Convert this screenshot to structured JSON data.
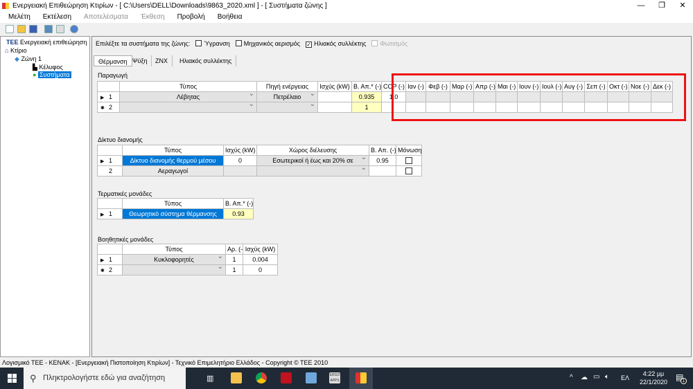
{
  "window": {
    "title": "Ενεργειακή Επιθεώρηση Κτιρίων - [ C:\\Users\\DELL\\Downloads\\9863_2020.xml ] - [ Συστήματα ζώνης ]"
  },
  "menu": [
    {
      "label": "Μελέτη",
      "enabled": true
    },
    {
      "label": "Εκτέλεση",
      "enabled": true
    },
    {
      "label": "Αποτελέσματα",
      "enabled": false
    },
    {
      "label": "Έκθεση",
      "enabled": false
    },
    {
      "label": "Προβολή",
      "enabled": true
    },
    {
      "label": "Βοήθεια",
      "enabled": true
    }
  ],
  "tree": {
    "root": "Ενεργειακή επιθεώρηση",
    "root_logo": "TEE",
    "building": "Κτίριο",
    "zone": "Ζώνη 1",
    "envelope": "Κέλυφος",
    "systems": "Συστήματα"
  },
  "systems_select": {
    "label": "Επιλέξτε τα συστήματα της ζώνης:",
    "options": [
      {
        "label": "Ύγρανση",
        "checked": false,
        "enabled": true
      },
      {
        "label": "Μηχανικός αερισμός",
        "checked": false,
        "enabled": true
      },
      {
        "label": "Ηλιακός συλλέκτης",
        "checked": true,
        "enabled": true
      },
      {
        "label": "Φωτισμός",
        "checked": false,
        "enabled": false
      }
    ]
  },
  "tabs": [
    {
      "label": "Θέρμανση",
      "active": true
    },
    {
      "label": "Ψύξη"
    },
    {
      "label": "ZNX"
    },
    {
      "label": "Ηλιακός συλλέκτης"
    }
  ],
  "production": {
    "title": "Παραγωγή",
    "headers": [
      "Τύπος",
      "Πηγή ενέργειας",
      "Ισχύς (kW)",
      "Β. Απ.* (-)",
      "COP (-)",
      "Ιαν (-)",
      "Φεβ (-)",
      "Μαρ (-)",
      "Απρ (-)",
      "Μαι (-)",
      "Ιουν (-)",
      "Ιουλ (-)",
      "Αυγ (-)",
      "Σεπ (-)",
      "Οκτ (-)",
      "Νοε (-)",
      "Δεκ (-)"
    ],
    "rows": [
      {
        "marker": "▶",
        "num": "1",
        "type": "Λέβητας",
        "source": "Πετρέλαιο",
        "power": "",
        "eff": "0.935",
        "cop": "1.0"
      },
      {
        "marker": "✱",
        "num": "2",
        "type": "",
        "source": "",
        "power": "",
        "eff": "1",
        "cop": ""
      }
    ]
  },
  "distribution": {
    "title": "Δίκτυο διανομής",
    "headers": [
      "Τύπος",
      "Ισχύς (kW)",
      "Χώρος διέλευσης",
      "Β. Απ. (-)",
      "Μόνωση"
    ],
    "rows": [
      {
        "marker": "▶",
        "num": "1",
        "type": "Δίκτυο διανομής θερμού μέσου",
        "power": "0",
        "space": "Εσωτερικοί  ή έως και 20% σε",
        "eff": "0.95",
        "insulated": false
      },
      {
        "marker": "",
        "num": "2",
        "type": "Αεραγωγοί",
        "power": "",
        "space": "",
        "eff": "",
        "insulated": false
      }
    ]
  },
  "terminal": {
    "title": "Τερματικές μονάδες",
    "headers": [
      "Τύπος",
      "Β. Απ.* (-)"
    ],
    "rows": [
      {
        "marker": "▶",
        "num": "1",
        "type": "Θεωρητικό σύστημα θέρμανσης",
        "eff": "0.93"
      }
    ]
  },
  "auxiliary": {
    "title": "Βοηθητικές μονάδες",
    "headers": [
      "Τύπος",
      "Αρ. (-)",
      "Ισχύς (kW)"
    ],
    "rows": [
      {
        "marker": "▶",
        "num": "1",
        "type": "Κυκλοφορητές",
        "count": "1",
        "power": "0.004"
      },
      {
        "marker": "✱",
        "num": "2",
        "type": "",
        "count": "1",
        "power": "0"
      }
    ]
  },
  "status": "Λογισμικό ΤΕΕ - ΚΕΝΑΚ  -  [Ενεργειακή Πιστοποίηση Κτιρίων]  -  Τεχνικό Επιμελητήριο Ελλάδος  -  Copyright © TEE 2010",
  "taskbar": {
    "search_placeholder": "Πληκτρολογήστε εδώ για αναζήτηση",
    "lang": "ΕΛ",
    "time": "4:22 μμ",
    "date": "22/1/2020",
    "notifications": "1",
    "ergo_label": "ERGO APPS"
  },
  "colors": {
    "selection": "#0078d7",
    "highlight_box": "#e11111",
    "readonly_yellow": "#ffffc0"
  }
}
